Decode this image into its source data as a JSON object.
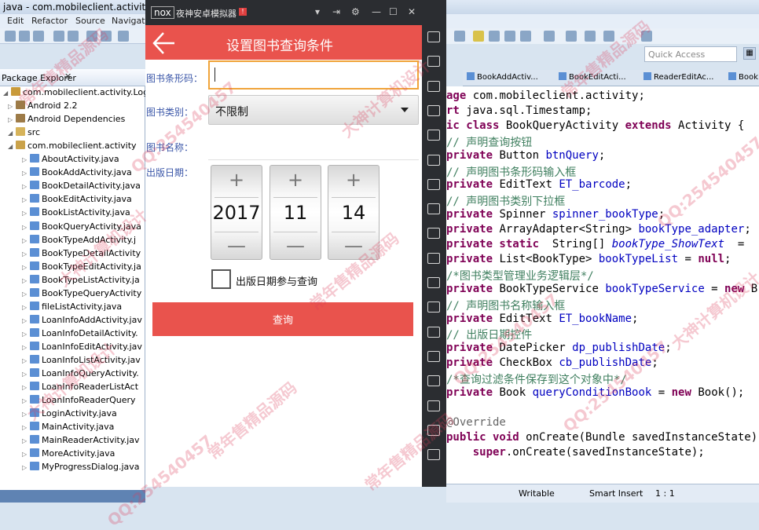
{
  "eclipse": {
    "title": "java - com.mobileclient.activity.LoginActivity",
    "menu": [
      "Edit",
      "Refactor",
      "Source",
      "Navigate"
    ],
    "quick_access_placeholder": "Quick Access",
    "package_explorer_title": "Package Explorer",
    "tree": [
      {
        "label": "com.mobileclient.activity.LoginAc",
        "icon": "project-icon",
        "depth": 0
      },
      {
        "label": "Android 2.2",
        "icon": "library-icon",
        "depth": 1
      },
      {
        "label": "Android Dependencies",
        "icon": "library-icon",
        "depth": 1
      },
      {
        "label": "src",
        "icon": "source-folder-icon",
        "depth": 1
      },
      {
        "label": "com.mobileclient.activity",
        "icon": "package-icon",
        "depth": 2
      },
      {
        "label": "AboutActivity.java",
        "icon": "java-file-icon",
        "depth": 3
      },
      {
        "label": "BookAddActivity.java",
        "icon": "java-file-icon",
        "depth": 3
      },
      {
        "label": "BookDetailActivity.java",
        "icon": "java-file-icon",
        "depth": 3
      },
      {
        "label": "BookEditActivity.java",
        "icon": "java-file-icon",
        "depth": 3
      },
      {
        "label": "BookListActivity.java",
        "icon": "java-file-icon",
        "depth": 3
      },
      {
        "label": "BookQueryActivity.java",
        "icon": "java-file-icon",
        "depth": 3
      },
      {
        "label": "BookTypeAddActivity.j",
        "icon": "java-file-icon",
        "depth": 3
      },
      {
        "label": "BookTypeDetailActivity",
        "icon": "java-file-icon",
        "depth": 3
      },
      {
        "label": "BookTypeEditActivity.ja",
        "icon": "java-file-icon",
        "depth": 3
      },
      {
        "label": "BookTypeListActivity.ja",
        "icon": "java-file-icon",
        "depth": 3
      },
      {
        "label": "BookTypeQueryActivity",
        "icon": "java-file-icon",
        "depth": 3
      },
      {
        "label": "fileListActivity.java",
        "icon": "java-file-icon",
        "depth": 3
      },
      {
        "label": "LoanInfoAddActivity.jav",
        "icon": "java-file-icon",
        "depth": 3
      },
      {
        "label": "LoanInfoDetailActivity.",
        "icon": "java-file-icon",
        "depth": 3
      },
      {
        "label": "LoanInfoEditActivity.jav",
        "icon": "java-file-icon",
        "depth": 3
      },
      {
        "label": "LoanInfoListActivity.jav",
        "icon": "java-file-icon",
        "depth": 3
      },
      {
        "label": "LoanInfoQueryActivity.",
        "icon": "java-file-icon",
        "depth": 3
      },
      {
        "label": "LoanInfoReaderListAct",
        "icon": "java-file-icon",
        "depth": 3
      },
      {
        "label": "LoanInfoReaderQuery",
        "icon": "java-file-icon",
        "depth": 3
      },
      {
        "label": "LoginActivity.java",
        "icon": "java-file-icon",
        "depth": 3
      },
      {
        "label": "MainActivity.java",
        "icon": "java-file-icon",
        "depth": 3
      },
      {
        "label": "MainReaderActivity.jav",
        "icon": "java-file-icon",
        "depth": 3
      },
      {
        "label": "MoreActivity.java",
        "icon": "java-file-icon",
        "depth": 3
      },
      {
        "label": "MyProgressDialog.java",
        "icon": "java-file-icon",
        "depth": 3
      }
    ],
    "editor_tabs": [
      "BookAddActiv...",
      "BookEditActi...",
      "ReaderEditAc...",
      "Book"
    ],
    "code_lines": [
      {
        "text": "age com.mobileclient.activity;",
        "style": "pkg"
      },
      {
        "text": "rt java.sql.Timestamp;",
        "style": "imp"
      },
      {
        "text": "ic class BookQueryActivity extends Activity {",
        "style": "cls"
      },
      {
        "text": "// 声明查询按钮",
        "style": "cmt"
      },
      {
        "text": "private Button btnQuery;",
        "style": "decl",
        "type": "Button",
        "name": "btnQuery"
      },
      {
        "text": "// 声明图书条形码输入框",
        "style": "cmt"
      },
      {
        "text": "private EditText ET_barcode;",
        "style": "decl",
        "type": "EditText",
        "name": "ET_barcode"
      },
      {
        "text": "// 声明图书类别下拉框",
        "style": "cmt"
      },
      {
        "text": "private Spinner spinner_bookType;",
        "style": "decl",
        "type": "Spinner",
        "name": "spinner_bookType"
      },
      {
        "text": "private ArrayAdapter<String> bookType_adapter;",
        "style": "decl",
        "type": "ArrayAdapter<String>",
        "name": "bookType_adapter"
      },
      {
        "text": "private static  String[] bookType_ShowText  = ",
        "style": "static"
      },
      {
        "text": "private List<BookType> bookTypeList = null;",
        "style": "list"
      },
      {
        "text": "/*图书类型管理业务逻辑层*/",
        "style": "cmt"
      },
      {
        "text": "private BookTypeService bookTypeService = new B",
        "style": "svc"
      },
      {
        "text": "// 声明图书名称输入框",
        "style": "cmt"
      },
      {
        "text": "private EditText ET_bookName;",
        "style": "decl",
        "type": "EditText",
        "name": "ET_bookName"
      },
      {
        "text": "// 出版日期控件",
        "style": "cmt"
      },
      {
        "text": "private DatePicker dp_publishDate;",
        "style": "decl",
        "type": "DatePicker",
        "name": "dp_publishDate"
      },
      {
        "text": "private CheckBox cb_publishDate;",
        "style": "decl",
        "type": "CheckBox",
        "name": "cb_publishDate"
      },
      {
        "text": "/*查询过滤条件保存到这个对象中*/",
        "style": "cmt"
      },
      {
        "text": "private Book queryConditionBook = new Book();",
        "style": "book"
      },
      {
        "text": "",
        "style": "blank"
      },
      {
        "text": "@Override",
        "style": "ann"
      },
      {
        "text": "public void onCreate(Bundle savedInstanceState)",
        "style": "method"
      },
      {
        "text": "    super.onCreate(savedInstanceState);",
        "style": "super"
      }
    ],
    "status": {
      "writable": "Writable",
      "insert": "Smart Insert",
      "position": "1 : 1"
    }
  },
  "emulator": {
    "logo": "nox",
    "name": "夜神安卓模拟器",
    "badge": "!",
    "controls": [
      "▾",
      "⇥",
      "⚙",
      "—",
      "☐",
      "✕"
    ],
    "sidebar_icons": [
      "shake-icon",
      "robot-icon",
      "cut-icon",
      "location-icon",
      "keyboard-icon",
      "resize-icon",
      "volume-up-icon",
      "volume-down-icon",
      "install-icon",
      "loading-icon",
      "screenshot-icon",
      "video-icon",
      "toolbox-icon",
      "menu-icon",
      "multi-window-icon",
      "back-icon",
      "home-icon",
      "recent-apps-icon"
    ]
  },
  "app": {
    "title": "设置图书查询条件",
    "barcode_label": "图书条形码：",
    "barcode_value": "",
    "booktype_label": "图书类别：",
    "booktype_value": "不限制",
    "bookname_label": "图书名称：",
    "bookname_value": "",
    "publish_date_label": "出版日期：",
    "date": {
      "year": "2017",
      "month": "11",
      "day": "14"
    },
    "plus_symbol": "+",
    "minus_symbol": "—",
    "checkbox_label": "出版日期参与查询",
    "checkbox_checked": false,
    "query_button": "查询"
  },
  "colors": {
    "app_bar": "#e9534d",
    "focus_border": "#f0a43a",
    "label_blue": "#3a56a8"
  },
  "watermarks": [
    "常年售精品源码",
    "QQ:254540457",
    "大神计算机设计"
  ]
}
